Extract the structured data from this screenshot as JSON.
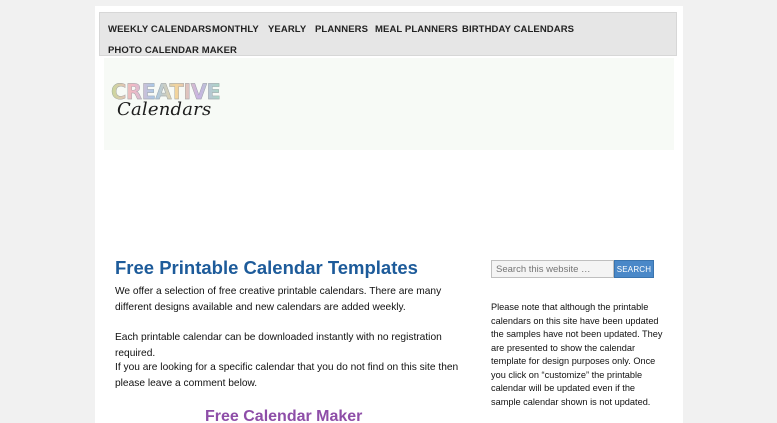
{
  "nav": {
    "items": [
      {
        "label": "WEEKLY CALENDARS"
      },
      {
        "label": "MONTHLY"
      },
      {
        "label": "YEARLY"
      },
      {
        "label": "PLANNERS"
      },
      {
        "label": "MEAL PLANNERS"
      },
      {
        "label": "BIRTHDAY CALENDARS"
      },
      {
        "label": "PHOTO CALENDAR MAKER"
      }
    ]
  },
  "logo": {
    "top_text": "CREATIVE",
    "bottom_text": "Calendars"
  },
  "main": {
    "title": "Free Printable Calendar Templates",
    "paragraphs": [
      "We offer a selection of free creative printable calendars. There are many different designs available and new calendars are added weekly.",
      "Each printable calendar can be downloaded instantly with no registration required.",
      "If you are looking for a specific calendar that you do not find on this site then please leave a comment below."
    ],
    "subtitle": "Free Calendar Maker"
  },
  "sidebar": {
    "search_placeholder": "Search this website …",
    "search_button": "SEARCH",
    "note": "Please note that although the printable calendars on this site have been updated the samples have not been updated. They are presented to show the calendar template for design purposes only. Once you click on “customize” the printable calendar will be updated even if the sample calendar shown is not updated."
  }
}
